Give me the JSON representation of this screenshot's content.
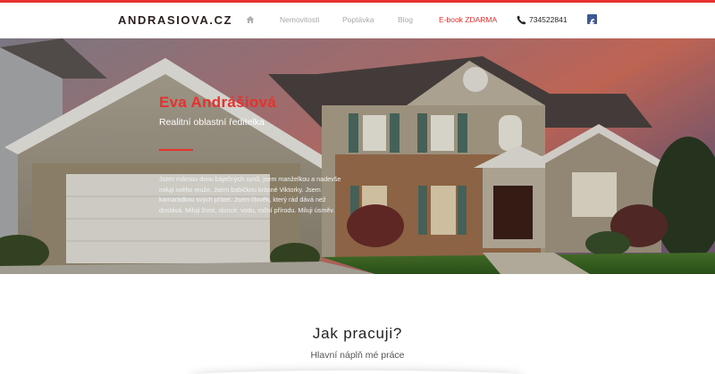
{
  "brand": {
    "logo": "ANDRASIOVA.CZ",
    "accent": "#e8312d"
  },
  "nav": {
    "home_icon": "home-icon",
    "items": [
      "Nemovitosti",
      "Poptávka",
      "Blog",
      "E-book ZDARMA"
    ],
    "phone_icon": "phone-icon",
    "phone": "734522841",
    "social_icon": "facebook-icon"
  },
  "hero": {
    "name": "Eva Andrášiová",
    "role": "Realitní oblastní ředitelka",
    "bio": "Jsem mámou dvou báječných synů, jsem manželkou a nadevše miluji svého muže. Jsem babičkou krásné Viktorky. Jsem kamarádkou svých přátel. Jsem člověk, který rád dává než dostává. Miluji život, slunce, vodu, roční přírodu. Miluji úsměv."
  },
  "section": {
    "title": "Jak pracuji?",
    "subtitle": "Hlavní náplň mé práce"
  }
}
